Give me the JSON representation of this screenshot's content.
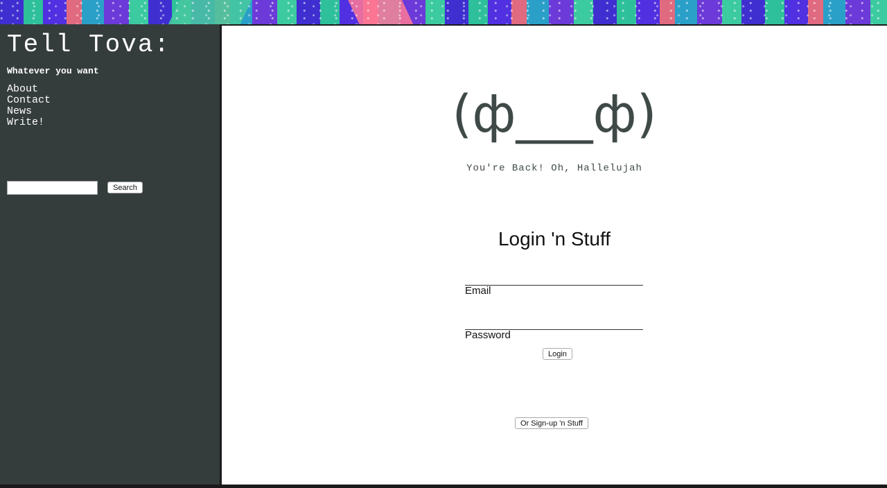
{
  "sidebar": {
    "title": "Tell Tova:",
    "tagline": "Whatever you want",
    "nav": [
      "About",
      "Contact",
      "News",
      "Write!"
    ],
    "search_button": "Search"
  },
  "main": {
    "face": "(ф___ф)",
    "welcome": "You're Back! Oh, Hallelujah",
    "login_title": "Login 'n Stuff",
    "email_label": "Email",
    "password_label": "Password",
    "login_button": "Login",
    "signup_button": "Or Sign-up 'n Stuff"
  },
  "colors": {
    "sidebar_bg": "#353d3c",
    "face_color": "#3f4a48"
  }
}
